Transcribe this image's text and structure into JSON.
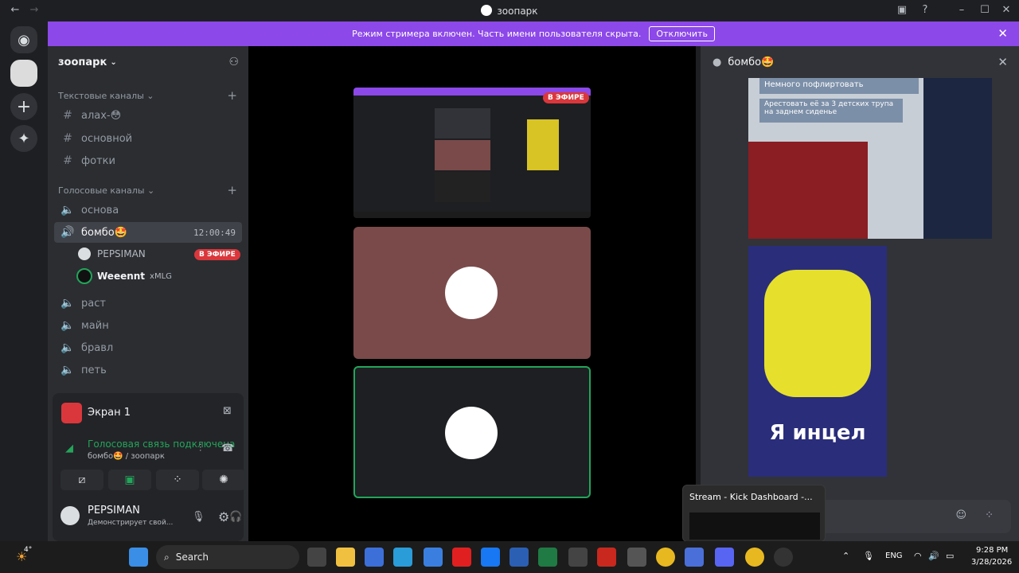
{
  "window": {
    "title": "зоопарк"
  },
  "banner": {
    "text": "Режим стримера включен. Часть имени пользователя скрыта.",
    "button": "Отключить"
  },
  "server": {
    "name": "зоопарк"
  },
  "categories": {
    "text": "Текстовые каналы",
    "voice": "Голосовые каналы"
  },
  "text_channels": [
    "алах-😳",
    "основной",
    "фотки"
  ],
  "voice_channels_top": [
    "основа"
  ],
  "active_channel": {
    "name": "бомбо🤩",
    "time": "12:00:49"
  },
  "members": [
    {
      "name": "PEPSIMAN",
      "badge": "В ЭФИРЕ"
    },
    {
      "name": "Weeennt",
      "tag": "xMLG"
    }
  ],
  "voice_channels_bottom": [
    "раст",
    "майн",
    "бравл",
    "петь"
  ],
  "screen_panel": {
    "title": "Экран 1",
    "status": "Голосовая связь подключена",
    "location": "бомбо🤩 / зоопарк"
  },
  "user": {
    "name": "PEPSIMAN",
    "status": "Демонстрирует свой..."
  },
  "stream_preview": {
    "badge": "В ЭФИРЕ"
  },
  "chat": {
    "channel": "бомбо🤩",
    "meme_text_1": "Немного пофлиртовать",
    "meme_text_2": "Арестовать её за 3 детских трупа на заднем сиденье",
    "meme_caption": "Я инцел"
  },
  "tooltip": {
    "text": "Stream - Kick Dashboard -..."
  },
  "taskbar": {
    "search": "Search",
    "lang": "ENG",
    "time": "9:28 PM",
    "date": "3/28/2026",
    "weather": "4°"
  },
  "colors": {
    "accent": "#8c48e8",
    "live": "#da373c",
    "online": "#23a55a"
  }
}
